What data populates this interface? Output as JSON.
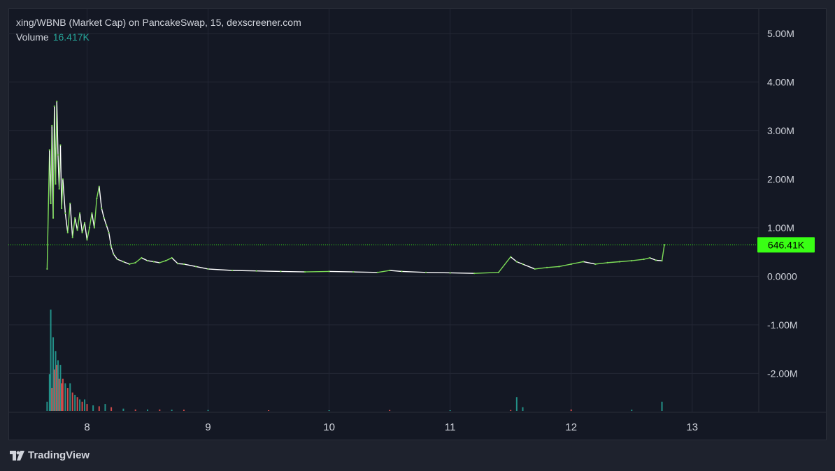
{
  "header": {
    "title": "xing/WBNB (Market Cap) on PancakeSwap, 15, dexscreener.com",
    "volume_label": "Volume",
    "volume_value": "16.417K"
  },
  "brand": {
    "name": "TradingView"
  },
  "colors": {
    "up": "#7ddc58",
    "down": "#ffffff",
    "vol_up": "#26a69a",
    "vol_down": "#ef5350",
    "price_tag": "#39ff14"
  },
  "chart_data": {
    "type": "line",
    "y_unit": "market cap (USD)",
    "ylim": [
      -2800000,
      5500000
    ],
    "y_ticks": [
      5000000,
      4000000,
      3000000,
      2000000,
      1000000,
      0,
      -1000000,
      -2000000
    ],
    "y_tick_labels": [
      "5.00M",
      "4.00M",
      "3.00M",
      "2.00M",
      "1.00M",
      "0.0000",
      "-1.00M",
      "-2.00M"
    ],
    "x_ticks": [
      8,
      9,
      10,
      11,
      12,
      13
    ],
    "x_tick_labels": [
      "8",
      "9",
      "10",
      "11",
      "12",
      "13"
    ],
    "xlim": [
      7.35,
      13.55
    ],
    "last_price": 646410,
    "last_price_label": "646.41K",
    "grid": true,
    "series": [
      {
        "x": [
          7.67,
          7.69,
          7.7,
          7.71,
          7.72,
          7.73,
          7.74,
          7.75,
          7.76,
          7.77,
          7.78,
          7.79,
          7.8,
          7.82,
          7.84,
          7.86,
          7.88,
          7.9,
          7.92,
          7.94,
          7.96,
          7.98,
          8.0,
          8.02,
          8.04,
          8.06,
          8.08,
          8.1,
          8.12,
          8.14,
          8.16,
          8.18,
          8.2,
          8.22,
          8.25,
          8.3,
          8.35,
          8.4,
          8.45,
          8.5,
          8.55,
          8.6,
          8.65,
          8.7,
          8.75,
          8.8,
          8.9,
          9.0,
          9.2,
          9.4,
          9.6,
          9.8,
          10.0,
          10.2,
          10.4,
          10.5,
          10.6,
          10.8,
          11.0,
          11.2,
          11.4,
          11.5,
          11.55,
          11.6,
          11.7,
          11.8,
          11.9,
          12.0,
          12.1,
          12.2,
          12.3,
          12.4,
          12.5,
          12.6,
          12.65,
          12.7,
          12.75,
          12.77
        ],
        "values": [
          150000,
          2600000,
          1500000,
          3100000,
          1200000,
          3500000,
          1900000,
          3600000,
          2500000,
          1800000,
          2700000,
          1400000,
          2000000,
          1300000,
          900000,
          1500000,
          800000,
          1200000,
          950000,
          1300000,
          900000,
          1100000,
          750000,
          1000000,
          1300000,
          1000000,
          1600000,
          1850000,
          1400000,
          1200000,
          1050000,
          900000,
          600000,
          450000,
          350000,
          300000,
          250000,
          280000,
          380000,
          320000,
          300000,
          280000,
          320000,
          380000,
          260000,
          250000,
          200000,
          150000,
          120000,
          110000,
          100000,
          90000,
          100000,
          90000,
          80000,
          120000,
          100000,
          80000,
          70000,
          60000,
          80000,
          400000,
          300000,
          250000,
          150000,
          180000,
          200000,
          250000,
          300000,
          250000,
          280000,
          300000,
          320000,
          350000,
          380000,
          330000,
          320000,
          646410
        ]
      }
    ],
    "volume": {
      "x": [
        7.67,
        7.69,
        7.7,
        7.71,
        7.72,
        7.73,
        7.74,
        7.75,
        7.76,
        7.77,
        7.78,
        7.79,
        7.8,
        7.82,
        7.84,
        7.86,
        7.88,
        7.9,
        7.92,
        7.94,
        7.96,
        7.98,
        8.0,
        8.05,
        8.1,
        8.15,
        8.2,
        8.3,
        8.4,
        8.5,
        8.6,
        8.7,
        8.8,
        9.0,
        9.5,
        10.0,
        10.5,
        11.0,
        11.5,
        11.55,
        11.6,
        12.0,
        12.5,
        12.75
      ],
      "values": [
        2000,
        8000,
        22000,
        5000,
        16000,
        9000,
        13000,
        10000,
        11000,
        7000,
        10000,
        6000,
        7000,
        6000,
        5000,
        6000,
        4000,
        3500,
        3000,
        2500,
        2000,
        2500,
        1500,
        1200,
        1000,
        1500,
        800,
        500,
        300,
        300,
        300,
        250,
        250,
        200,
        150,
        150,
        200,
        150,
        200,
        3000,
        800,
        300,
        250,
        2000
      ],
      "up": [
        true,
        true,
        true,
        false,
        true,
        false,
        true,
        false,
        true,
        false,
        true,
        false,
        false,
        true,
        false,
        true,
        false,
        true,
        false,
        true,
        false,
        true,
        false,
        true,
        false,
        true,
        false,
        true,
        false,
        true,
        false,
        true,
        false,
        true,
        false,
        true,
        false,
        true,
        false,
        true,
        true,
        false,
        true,
        true
      ]
    }
  }
}
